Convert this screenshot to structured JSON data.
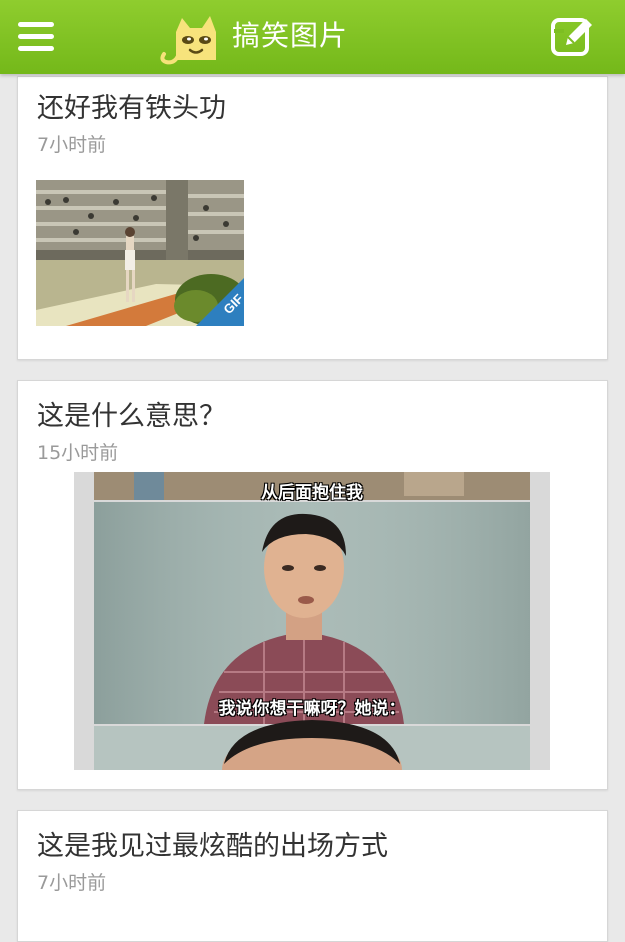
{
  "header": {
    "title": "搞笑图片",
    "menu_icon": "hamburger-menu-icon",
    "compose_icon": "edit-compose-icon",
    "accent_color": "#7dbe22"
  },
  "posts": [
    {
      "title": "还好我有铁头功",
      "time": "7小时前",
      "badge": "GIF"
    },
    {
      "title": "这是什么意思？",
      "time": "15小时前",
      "subtitle_top": "从后面抱住我",
      "subtitle_bottom": "我说你想干嘛呀？她说："
    },
    {
      "title": "这是我见过最炫酷的出场方式",
      "time": "7小时前"
    }
  ]
}
